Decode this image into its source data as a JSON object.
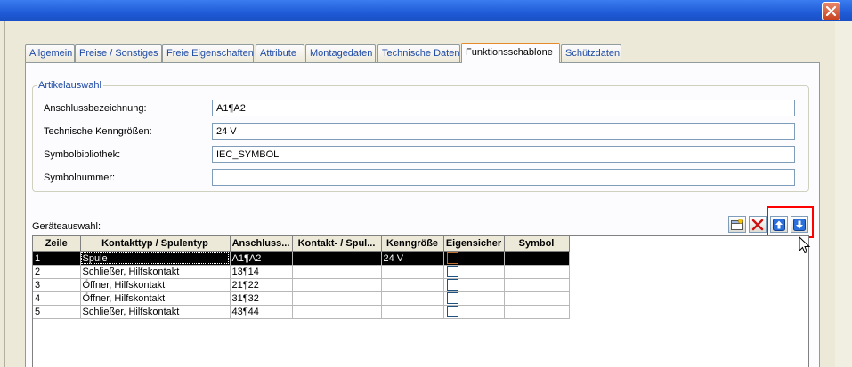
{
  "window": {
    "close_symbol": "✕"
  },
  "tabs": [
    {
      "label": "Allgemein",
      "active": false
    },
    {
      "label": "Preise / Sonstiges",
      "active": false
    },
    {
      "label": "Freie Eigenschaften",
      "active": false
    },
    {
      "label": "Attribute",
      "active": false
    },
    {
      "label": "Montagedaten",
      "active": false
    },
    {
      "label": "Technische Daten",
      "active": false
    },
    {
      "label": "Funktionsschablone",
      "active": true
    },
    {
      "label": "Schützdaten",
      "active": false
    }
  ],
  "artikelauswahl": {
    "legend": "Artikelauswahl",
    "fields": [
      {
        "label": "Anschlussbezeichnung:",
        "value": "A1¶A2"
      },
      {
        "label": "Technische Kenngrößen:",
        "value": "24 V"
      },
      {
        "label": "Symbolbibliothek:",
        "value": "IEC_SYMBOL"
      },
      {
        "label": "Symbolnummer:",
        "value": ""
      }
    ]
  },
  "geraeteauswahl": {
    "label": "Geräteauswahl:",
    "toolbar": {
      "new_icon": "new-row-icon",
      "delete_icon": "delete-icon",
      "up_icon": "move-up-icon",
      "down_icon": "move-down-icon"
    },
    "columns": [
      "Zeile",
      "Kontakttyp / Spulentyp",
      "Anschluss...",
      "Kontakt- / Spul...",
      "Kenngröße",
      "Eigensicher",
      "Symbol"
    ],
    "rows": [
      {
        "zeile": "1",
        "typ": "Spule",
        "anschluss": "A1¶A2",
        "kontakt": "",
        "kenngroesse": "24 V",
        "eigensicher": false,
        "symbol": "",
        "selected": true
      },
      {
        "zeile": "2",
        "typ": "Schließer, Hilfskontakt",
        "anschluss": "13¶14",
        "kontakt": "",
        "kenngroesse": "",
        "eigensicher": false,
        "symbol": "",
        "selected": false
      },
      {
        "zeile": "3",
        "typ": "Öffner, Hilfskontakt",
        "anschluss": "21¶22",
        "kontakt": "",
        "kenngroesse": "",
        "eigensicher": false,
        "symbol": "",
        "selected": false
      },
      {
        "zeile": "4",
        "typ": "Öffner, Hilfskontakt",
        "anschluss": "31¶32",
        "kontakt": "",
        "kenngroesse": "",
        "eigensicher": false,
        "symbol": "",
        "selected": false
      },
      {
        "zeile": "5",
        "typ": "Schließer, Hilfskontakt",
        "anschluss": "43¶44",
        "kontakt": "",
        "kenngroesse": "",
        "eigensicher": false,
        "symbol": "",
        "selected": false
      }
    ]
  },
  "colors": {
    "titlebar": "#1f5bd6",
    "tab_text": "#1f4ba6",
    "active_tab_accent": "#e68b2c",
    "highlight": "#ff0000",
    "up_down_arrow": "#1f5bd6",
    "delete_x": "#d01010"
  }
}
